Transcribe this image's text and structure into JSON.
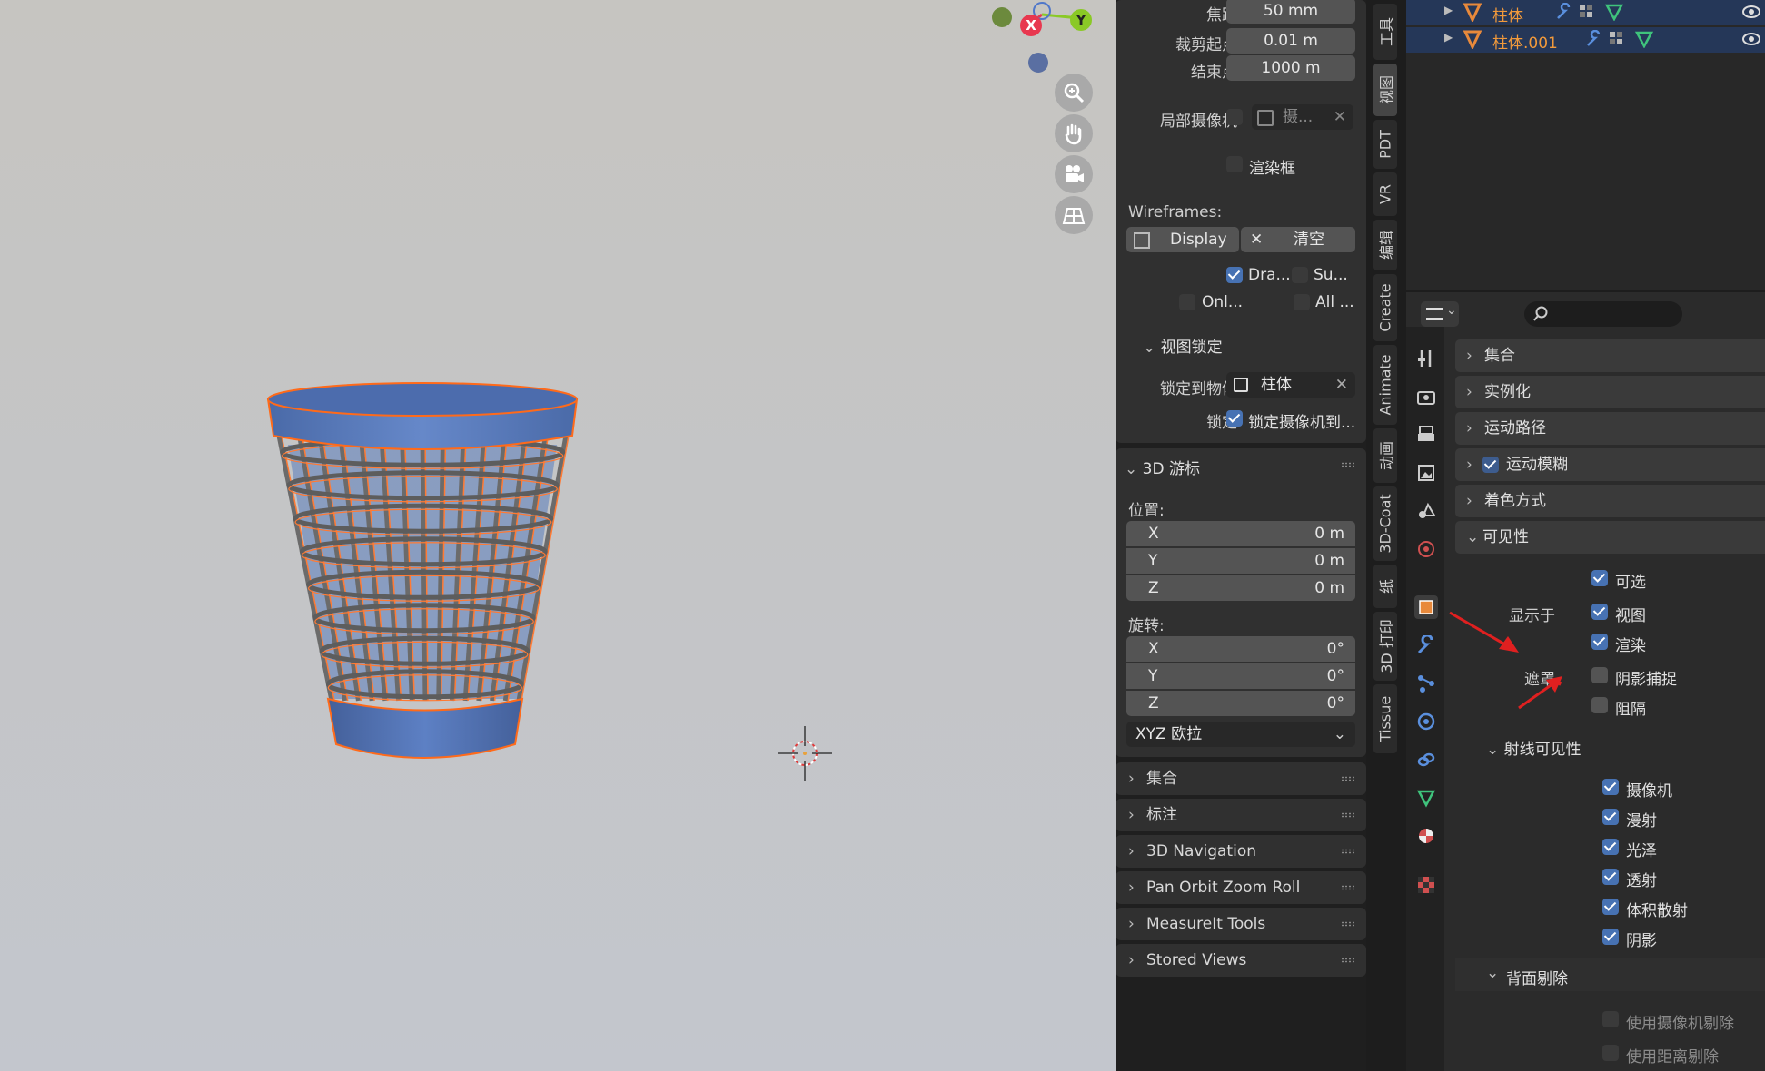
{
  "viewport": {
    "gizmo": {
      "x": "X",
      "y": "Y"
    },
    "colors": {
      "bg_top": "#c6c5c1",
      "bg_bottom": "#c3c6cd",
      "basket_blue": "#5b7fbf",
      "selection_orange": "#ff6a1a"
    },
    "nav_icons": [
      "zoom-icon",
      "hand-pan-icon",
      "camera-icon",
      "grid-icon"
    ]
  },
  "npanel": {
    "view": {
      "focal_label": "焦距",
      "focal_value": "50 mm",
      "clip_start_label": "裁剪起点",
      "clip_start_value": "0.01 m",
      "clip_end_label": "结束点",
      "clip_end_value": "1000 m",
      "local_camera_label": "局部摄像机",
      "local_camera_value": "摄...",
      "render_region_label": "渲染框",
      "wireframes_label": "Wireframes:",
      "display_label": "Display",
      "clear_label": "清空",
      "opt_dra": "Dra...",
      "opt_su": "Su...",
      "opt_onl": "Onl...",
      "opt_all": "All ...",
      "view_lock_label": "视图锁定",
      "lock_object_label": "锁定到物体",
      "lock_object_value": "柱体",
      "lock_label": "锁定",
      "lock_camera_label": "锁定摄像机到..."
    },
    "cursor": {
      "title": "3D 游标",
      "location_label": "位置:",
      "loc_x_label": "X",
      "loc_x": "0 m",
      "loc_y_label": "Y",
      "loc_y": "0 m",
      "loc_z_label": "Z",
      "loc_z": "0 m",
      "rotation_label": "旋转:",
      "rot_x_label": "X",
      "rot_x": "0°",
      "rot_y_label": "Y",
      "rot_y": "0°",
      "rot_z_label": "Z",
      "rot_z": "0°",
      "rotation_mode": "XYZ 欧拉"
    },
    "collapsed_panels": [
      "集合",
      "标注",
      "3D Navigation",
      "Pan Orbit Zoom Roll",
      "MeasureIt Tools",
      "Stored Views"
    ]
  },
  "tabs": [
    "工具",
    "视图",
    "PDT",
    "VR",
    "编辑",
    "Create",
    "Animate",
    "动画",
    "3D-Coat",
    "纸",
    "3D 打印",
    "Tissue"
  ],
  "outliner": {
    "rows": [
      {
        "name": "柱体"
      },
      {
        "name": "柱体.001"
      }
    ]
  },
  "properties": {
    "search_placeholder": "",
    "sections": {
      "collection": "集合",
      "instancing": "实例化",
      "motion_paths": "运动路径",
      "motion_blur": "运动模糊",
      "shading": "着色方式",
      "visibility": "可见性"
    },
    "visibility": {
      "selectable": "可选",
      "show_in_label": "显示于",
      "viewport": "视图",
      "render": "渲染",
      "mask_label": "遮罩",
      "shadow_catcher": "阴影捕捉",
      "holdout": "阻隔"
    },
    "ray_visibility": {
      "title": "射线可见性",
      "camera": "摄像机",
      "diffuse": "漫射",
      "glossy": "光泽",
      "transmission": "透射",
      "volume_scatter": "体积散射",
      "shadow": "阴影"
    },
    "culling": {
      "title": "背面剔除",
      "camera_cull": "使用摄像机剔除",
      "distance_cull": "使用距离剔除"
    }
  }
}
